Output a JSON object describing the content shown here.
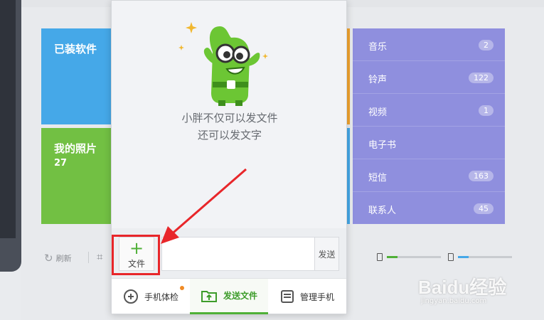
{
  "tiles": {
    "installed": {
      "title": "已装软件"
    },
    "photos": {
      "title": "我的照片",
      "count": "27"
    }
  },
  "side_list": [
    {
      "label": "音乐",
      "count": "2"
    },
    {
      "label": "铃声",
      "count": "122"
    },
    {
      "label": "视频",
      "count": "1"
    },
    {
      "label": "电子书",
      "count": ""
    },
    {
      "label": "短信",
      "count": "163"
    },
    {
      "label": "联系人",
      "count": "45"
    }
  ],
  "toolbar": {
    "refresh_label": "刷新"
  },
  "storage": [
    {
      "icon": "phone-icon",
      "fill_fraction": 0.2,
      "color": "#4fb037"
    },
    {
      "icon": "sd-card-icon",
      "fill_fraction": 0.2,
      "color": "#45a8e8"
    }
  ],
  "panel": {
    "message_line1": "小胖不仅可以发文件",
    "message_line2": "还可以发文字",
    "file_button_label": "文件",
    "send_button_label": "发送",
    "tabs": [
      {
        "label": "手机体检",
        "icon": "health-check-icon"
      },
      {
        "label": "发送文件",
        "icon": "send-file-icon"
      },
      {
        "label": "管理手机",
        "icon": "manage-phone-icon"
      }
    ]
  },
  "watermark": {
    "main": "Baidu经验",
    "sub": "jingyan.baidu.com"
  },
  "colors": {
    "accent_green": "#4fb037",
    "highlight_red": "#e8262a",
    "tile_blue": "#45a8e8",
    "tile_green": "#72c043",
    "list_purple": "#8f8fde"
  }
}
